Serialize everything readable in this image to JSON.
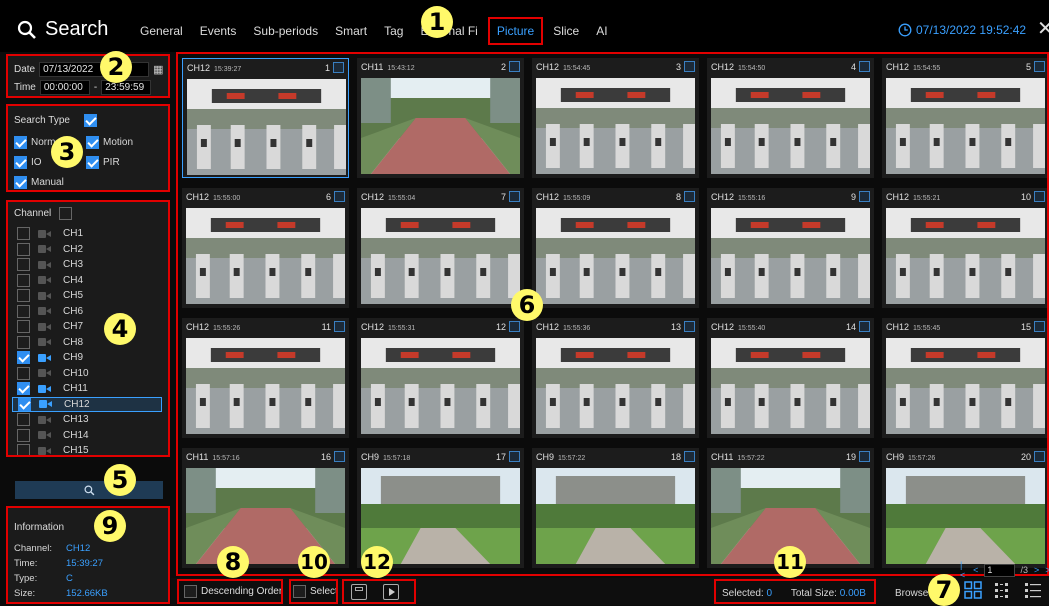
{
  "app": {
    "title": "Search",
    "tabs": [
      "General",
      "Events",
      "Sub-periods",
      "Smart",
      "Tag",
      "External Fi",
      "Picture",
      "Slice",
      "AI"
    ],
    "active_tab": "Picture",
    "datetime": "07/13/2022 19:52:42",
    "close": "✕"
  },
  "search": {
    "date_label": "Date",
    "date_value": "07/13/2022",
    "time_label": "Time",
    "time_start": "00:00:00",
    "time_end": "23:59:59",
    "type_label": "Search Type",
    "types": [
      {
        "label": "Normal",
        "checked": true
      },
      {
        "label": "Motion",
        "checked": true
      },
      {
        "label": "IO",
        "checked": true
      },
      {
        "label": "PIR",
        "checked": true
      },
      {
        "label": "Manual",
        "checked": true
      }
    ]
  },
  "channels": {
    "label": "Channel",
    "items": [
      {
        "name": "CH1",
        "checked": false
      },
      {
        "name": "CH2",
        "checked": false
      },
      {
        "name": "CH3",
        "checked": false
      },
      {
        "name": "CH4",
        "checked": false
      },
      {
        "name": "CH5",
        "checked": false
      },
      {
        "name": "CH6",
        "checked": false
      },
      {
        "name": "CH7",
        "checked": false
      },
      {
        "name": "CH8",
        "checked": false
      },
      {
        "name": "CH9",
        "checked": true
      },
      {
        "name": "CH10",
        "checked": false
      },
      {
        "name": "CH11",
        "checked": true
      },
      {
        "name": "CH12",
        "checked": true,
        "selected": true
      },
      {
        "name": "CH13",
        "checked": false
      },
      {
        "name": "CH14",
        "checked": false
      },
      {
        "name": "CH15",
        "checked": false
      }
    ]
  },
  "info": {
    "title": "Information",
    "channel_label": "Channel:",
    "channel": "CH12",
    "time_label": "Time:",
    "time": "15:39:27",
    "type_label": "Type:",
    "type": "C",
    "size_label": "Size:",
    "size": "152.66KB"
  },
  "thumbnails": [
    {
      "num": "1",
      "ch": "CH12",
      "time": "15:39:27",
      "scene": "gate",
      "selected": true
    },
    {
      "num": "2",
      "ch": "CH11",
      "time": "15:43:12",
      "scene": "walkway"
    },
    {
      "num": "3",
      "ch": "CH12",
      "time": "15:54:45",
      "scene": "gate"
    },
    {
      "num": "4",
      "ch": "CH12",
      "time": "15:54:50",
      "scene": "gate"
    },
    {
      "num": "5",
      "ch": "CH12",
      "time": "15:54:55",
      "scene": "gate"
    },
    {
      "num": "6",
      "ch": "CH12",
      "time": "15:55:00",
      "scene": "gate"
    },
    {
      "num": "7",
      "ch": "CH12",
      "time": "15:55:04",
      "scene": "gate"
    },
    {
      "num": "8",
      "ch": "CH12",
      "time": "15:55:09",
      "scene": "gate"
    },
    {
      "num": "9",
      "ch": "CH12",
      "time": "15:55:16",
      "scene": "gate"
    },
    {
      "num": "10",
      "ch": "CH12",
      "time": "15:55:21",
      "scene": "gate"
    },
    {
      "num": "11",
      "ch": "CH12",
      "time": "15:55:26",
      "scene": "gate"
    },
    {
      "num": "12",
      "ch": "CH12",
      "time": "15:55:31",
      "scene": "gate"
    },
    {
      "num": "13",
      "ch": "CH12",
      "time": "15:55:36",
      "scene": "gate"
    },
    {
      "num": "14",
      "ch": "CH12",
      "time": "15:55:40",
      "scene": "gate"
    },
    {
      "num": "15",
      "ch": "CH12",
      "time": "15:55:45",
      "scene": "gate"
    },
    {
      "num": "16",
      "ch": "CH11",
      "time": "15:57:16",
      "scene": "walkway"
    },
    {
      "num": "17",
      "ch": "CH9",
      "time": "15:57:18",
      "scene": "lawn"
    },
    {
      "num": "18",
      "ch": "CH9",
      "time": "15:57:22",
      "scene": "lawn"
    },
    {
      "num": "19",
      "ch": "CH11",
      "time": "15:57:22",
      "scene": "walkway"
    },
    {
      "num": "20",
      "ch": "CH9",
      "time": "15:57:26",
      "scene": "lawn"
    }
  ],
  "pager": {
    "page": "1",
    "total": "/3"
  },
  "bottom": {
    "descending": "Descending Order",
    "select": "Select",
    "selected_label": "Selected:",
    "selected": "0",
    "total_size_label": "Total Size:",
    "total_size": "0.00B",
    "browse_type": "Browse Type:"
  },
  "callouts": [
    "1",
    "2",
    "3",
    "4",
    "5",
    "6",
    "7",
    "8",
    "9",
    "10",
    "11",
    "12"
  ],
  "colors": {
    "accent": "#3aa0ff",
    "highlight": "#e20000",
    "callout": "#fff96a"
  }
}
